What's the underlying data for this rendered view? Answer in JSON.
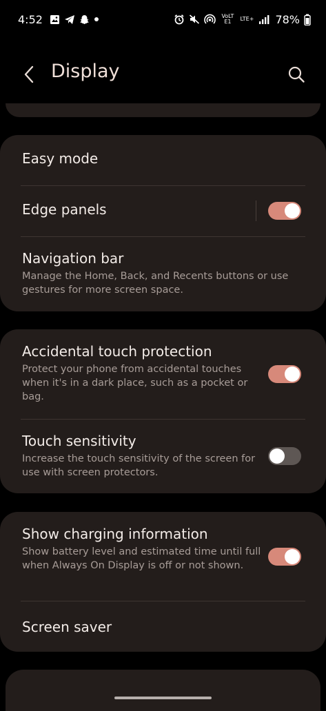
{
  "status_bar": {
    "time": "4:52",
    "volte_label": "VoLTE1",
    "lte_label": "LTE+",
    "battery": "78%"
  },
  "header": {
    "title": "Display"
  },
  "settings": {
    "easy_mode": {
      "title": "Easy mode"
    },
    "edge_panels": {
      "title": "Edge panels",
      "enabled": true
    },
    "navigation_bar": {
      "title": "Navigation bar",
      "subtitle": "Manage the Home, Back, and Recents buttons or use gestures for more screen space."
    },
    "accidental_touch": {
      "title": "Accidental touch protection",
      "subtitle": "Protect your phone from accidental touches when it's in a dark place, such as a pocket or bag.",
      "enabled": true
    },
    "touch_sensitivity": {
      "title": "Touch sensitivity",
      "subtitle": "Increase the touch sensitivity of the screen for use with screen protectors.",
      "enabled": false
    },
    "charging_info": {
      "title": "Show charging information",
      "subtitle": "Show battery level and estimated time until full when Always On Display is off or not shown.",
      "enabled": true
    },
    "screen_saver": {
      "title": "Screen saver"
    }
  },
  "colors": {
    "toggle_on": "#d7897a",
    "toggle_off": "#5e5754",
    "card_background": "#231d1b",
    "title_accent": "#f0e0d9"
  }
}
